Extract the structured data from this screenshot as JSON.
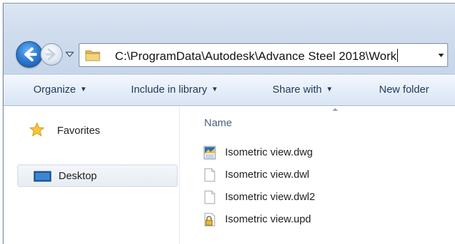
{
  "navigation": {
    "back_icon": "back-arrow-icon",
    "forward_icon": "forward-arrow-icon",
    "history_icon": "chevron-down-icon"
  },
  "address_bar": {
    "path": "C:\\ProgramData\\Autodesk\\Advance Steel 2018\\Work",
    "folder_icon": "folder-icon"
  },
  "toolbar": {
    "organize_label": "Organize",
    "include_label": "Include in library",
    "share_label": "Share with",
    "new_folder_label": "New folder"
  },
  "nav_pane": {
    "favorites_label": "Favorites",
    "desktop_label": "Desktop"
  },
  "content": {
    "column_name": "Name",
    "files": [
      {
        "name": "Isometric view.dwg",
        "icon": "dwg-file-icon"
      },
      {
        "name": "Isometric view.dwl",
        "icon": "blank-file-icon"
      },
      {
        "name": "Isometric view.dwl2",
        "icon": "blank-file-icon"
      },
      {
        "name": "Isometric view.upd",
        "icon": "locked-file-icon"
      }
    ]
  },
  "colors": {
    "toolbar_text": "#1e395b",
    "chrome_bg": "#cfdcee",
    "accent_blue": "#2f7fd6"
  }
}
